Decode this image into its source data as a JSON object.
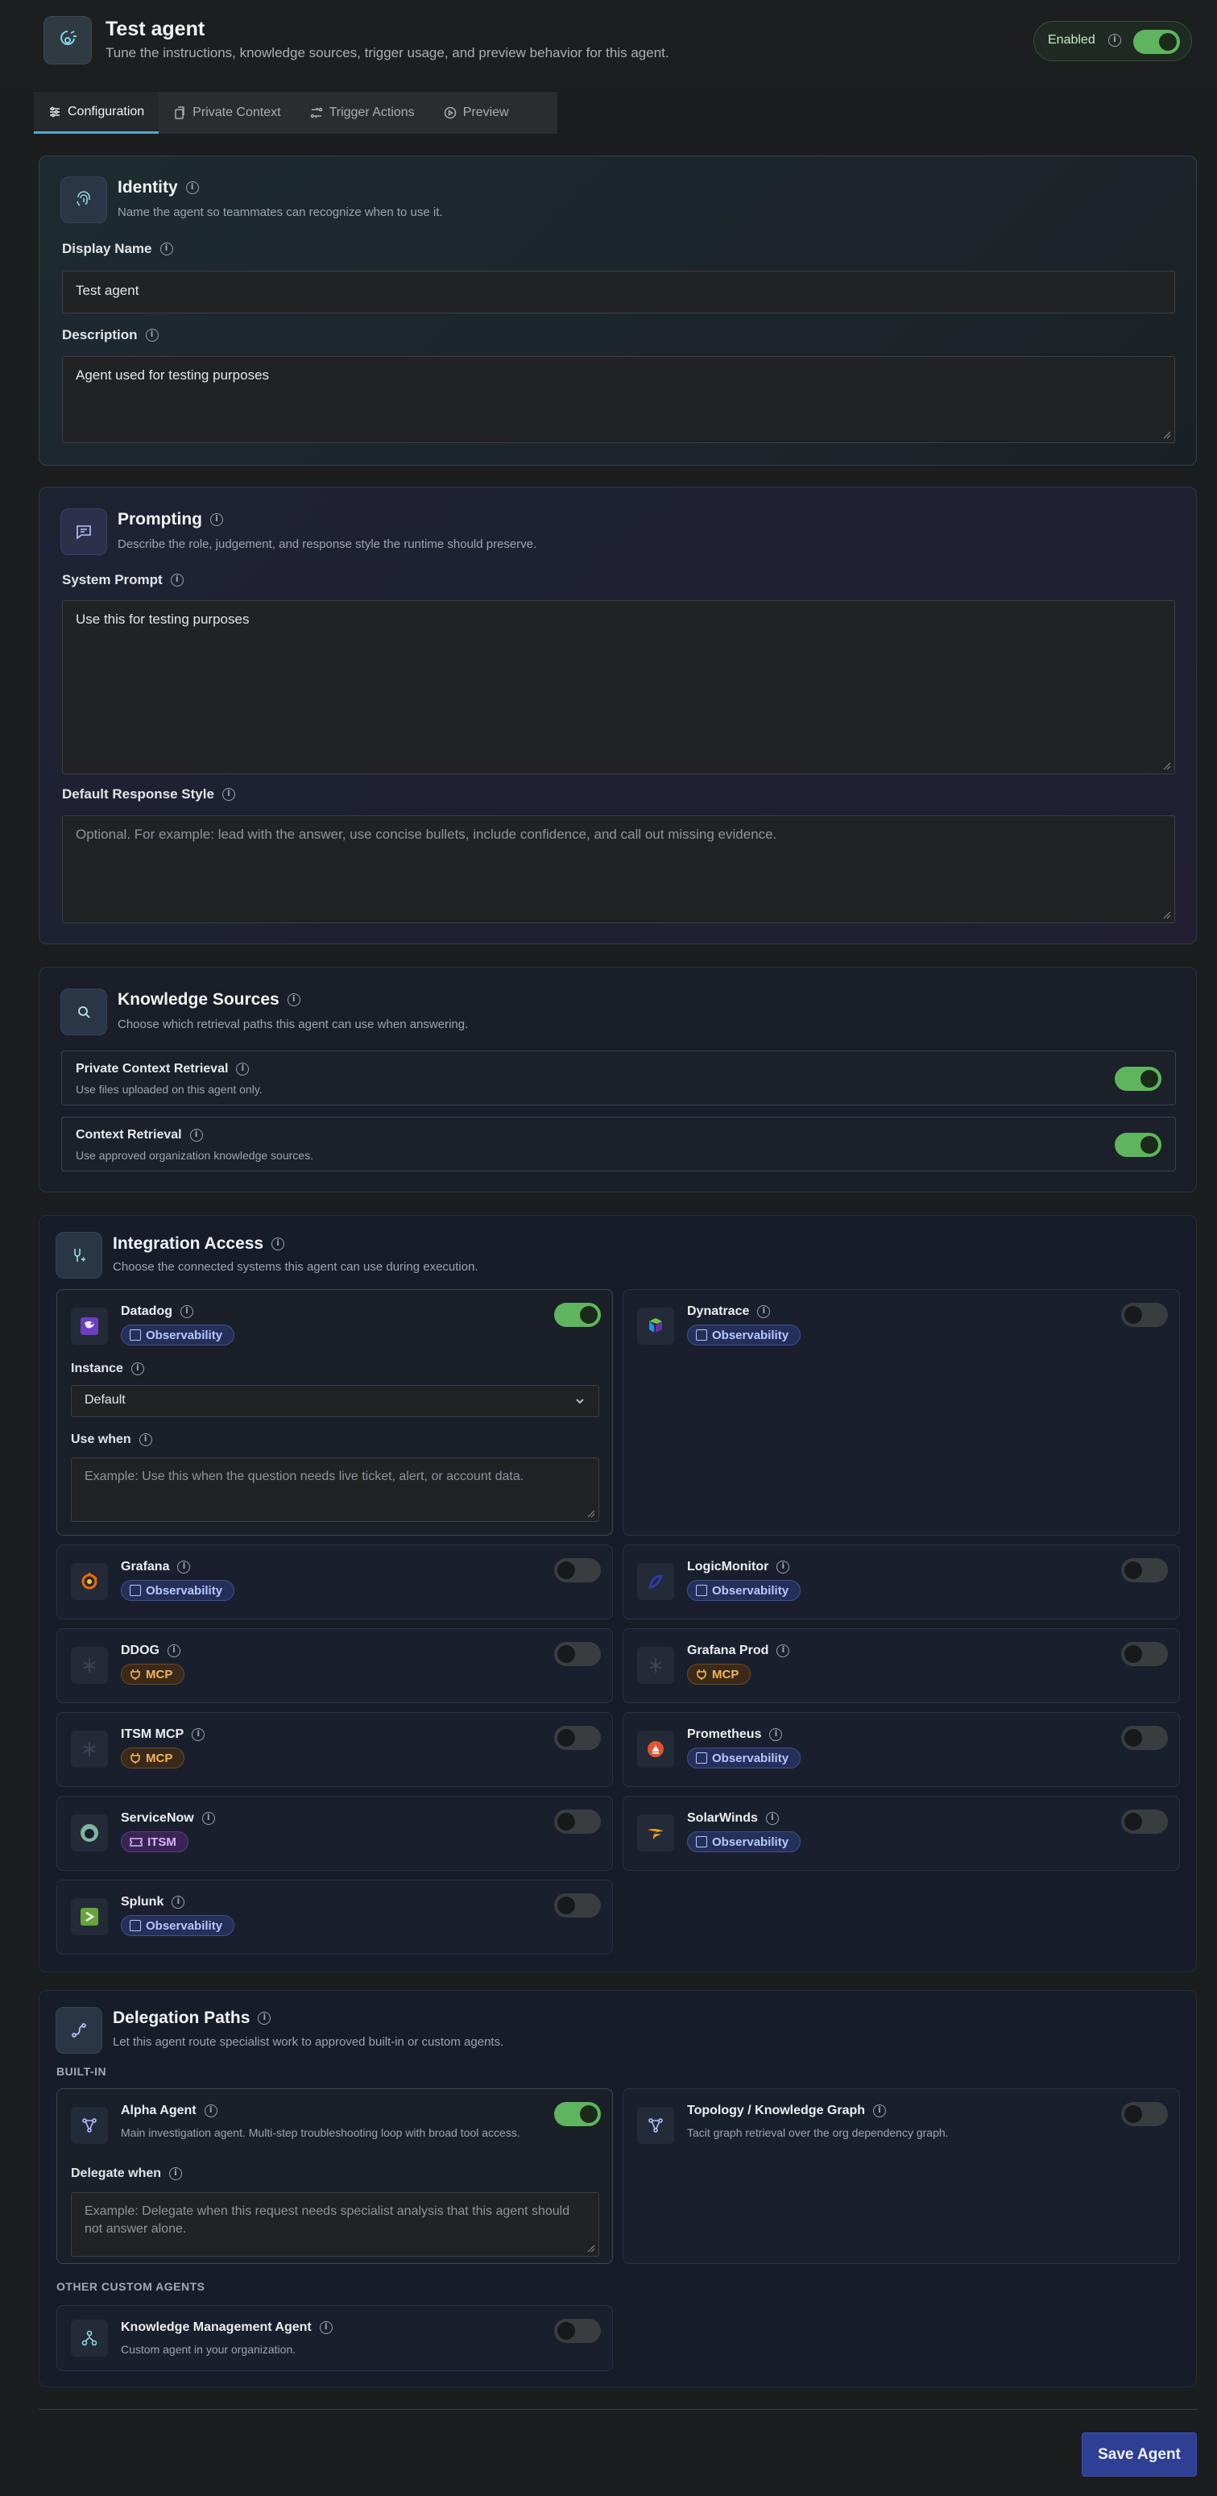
{
  "header": {
    "title": "Test agent",
    "subtitle": "Tune the instructions, knowledge sources, trigger usage, and preview behavior for this agent.",
    "enabled_label": "Enabled",
    "enabled": true
  },
  "tabs": [
    {
      "label": "Configuration",
      "icon": "sliders-icon",
      "active": true
    },
    {
      "label": "Private Context",
      "icon": "files-icon",
      "active": false
    },
    {
      "label": "Trigger Actions",
      "icon": "workflow-icon",
      "active": false
    },
    {
      "label": "Preview",
      "icon": "play-circle-icon",
      "active": false
    }
  ],
  "identity": {
    "title": "Identity",
    "subtitle": "Name the agent so teammates can recognize when to use it.",
    "display_name_label": "Display Name",
    "display_name_value": "Test agent",
    "description_label": "Description",
    "description_value": "Agent used for testing purposes"
  },
  "prompting": {
    "title": "Prompting",
    "subtitle": "Describe the role, judgement, and response style the runtime should preserve.",
    "system_prompt_label": "System Prompt",
    "system_prompt_value": "Use this for testing purposes",
    "response_style_label": "Default Response Style",
    "response_style_placeholder": "Optional. For example: lead with the answer, use concise bullets, include confidence, and call out missing evidence."
  },
  "knowledge": {
    "title": "Knowledge Sources",
    "subtitle": "Choose which retrieval paths this agent can use when answering.",
    "items": [
      {
        "title": "Private Context Retrieval",
        "subtitle": "Use files uploaded on this agent only.",
        "enabled": true
      },
      {
        "title": "Context Retrieval",
        "subtitle": "Use approved organization knowledge sources.",
        "enabled": true
      }
    ]
  },
  "integration": {
    "title": "Integration Access",
    "subtitle": "Choose the connected systems this agent can use during execution.",
    "instance_label": "Instance",
    "instance_value": "Default",
    "use_when_label": "Use when",
    "use_when_placeholder": "Example: Use this when the question needs live ticket, alert, or account data.",
    "items": [
      {
        "name": "Datadog",
        "badge": "Observability",
        "enabled": true
      },
      {
        "name": "Dynatrace",
        "badge": "Observability",
        "enabled": false
      },
      {
        "name": "Grafana",
        "badge": "Observability",
        "enabled": false
      },
      {
        "name": "LogicMonitor",
        "badge": "Observability",
        "enabled": false
      },
      {
        "name": "DDOG",
        "badge": "MCP",
        "enabled": false
      },
      {
        "name": "Grafana Prod",
        "badge": "MCP",
        "enabled": false
      },
      {
        "name": "ITSM MCP",
        "badge": "MCP",
        "enabled": false
      },
      {
        "name": "Prometheus",
        "badge": "Observability",
        "enabled": false
      },
      {
        "name": "ServiceNow",
        "badge": "ITSM",
        "enabled": false
      },
      {
        "name": "SolarWinds",
        "badge": "Observability",
        "enabled": false
      },
      {
        "name": "Splunk",
        "badge": "Observability",
        "enabled": false
      }
    ]
  },
  "delegation": {
    "title": "Delegation Paths",
    "subtitle": "Let this agent route specialist work to approved built-in or custom agents.",
    "builtin_label": "BUILT-IN",
    "custom_label": "OTHER CUSTOM AGENTS",
    "delegate_when_label": "Delegate when",
    "delegate_when_placeholder": "Example: Delegate when this request needs specialist analysis that this agent should not answer alone.",
    "builtin": [
      {
        "name": "Alpha Agent",
        "description": "Main investigation agent. Multi-step troubleshooting loop with broad tool access.",
        "enabled": true
      },
      {
        "name": "Topology / Knowledge Graph",
        "description": "Tacit graph retrieval over the org dependency graph.",
        "enabled": false
      }
    ],
    "custom": [
      {
        "name": "Knowledge Management Agent",
        "description": "Custom agent in your organization.",
        "enabled": false
      }
    ]
  },
  "footer": {
    "save_label": "Save Agent"
  },
  "colors": {
    "accent": "#5fb55d",
    "primary_button": "#2f3f93",
    "tab_underline": "#58a8c9"
  }
}
